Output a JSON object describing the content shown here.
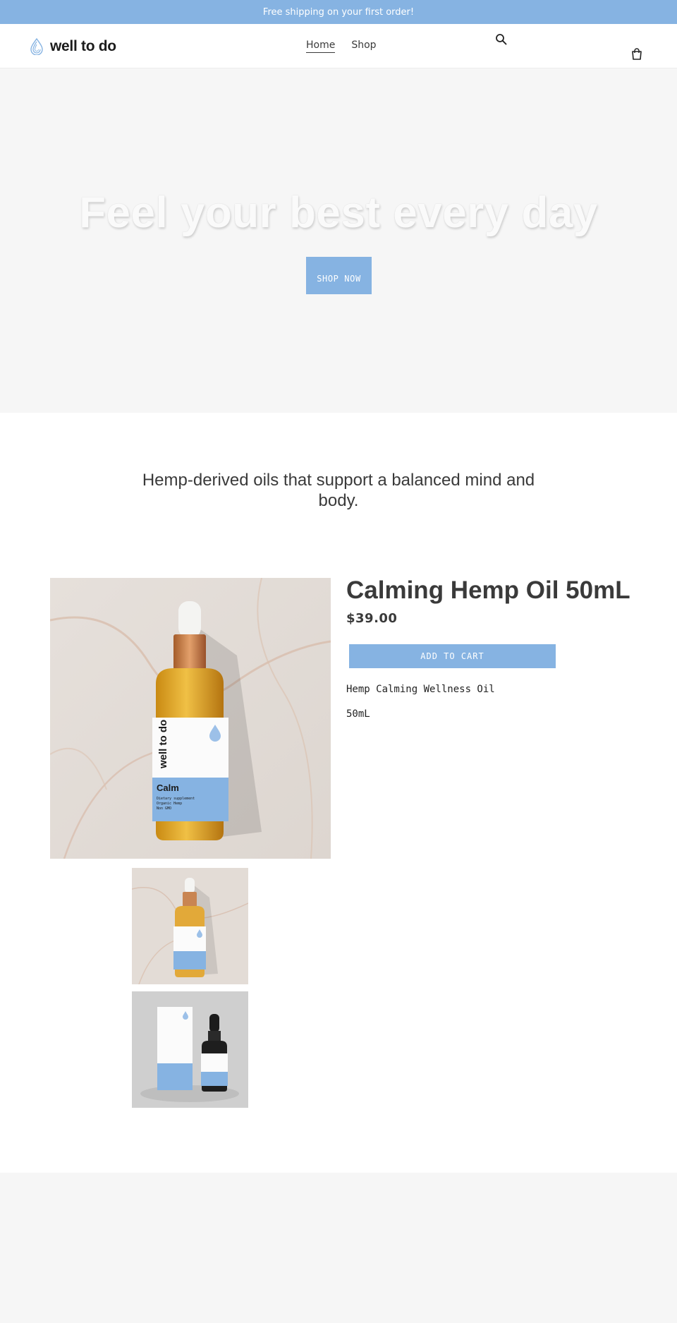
{
  "announcement": "Free shipping on your first order!",
  "brand": {
    "name": "well to do"
  },
  "nav": [
    {
      "label": "Home",
      "active": true
    },
    {
      "label": "Shop",
      "active": false
    }
  ],
  "icons": {
    "search": "search-icon",
    "cart": "cart-icon",
    "logo": "droplet-logo-icon"
  },
  "hero": {
    "title": "Feel your best every day",
    "button_label": "SHOP NOW"
  },
  "tagline": "Hemp-derived oils that support a balanced mind and body.",
  "product": {
    "title": "Calming Hemp Oil 50mL",
    "price": "$39.00",
    "add_to_cart": "ADD TO CART",
    "description_lines": [
      "Hemp Calming Wellness Oil",
      "50mL"
    ],
    "label": {
      "brand": "well to do",
      "name": "Calm",
      "details": [
        "Dietary supplement",
        "Organic Hemp",
        "Non GMO"
      ]
    }
  },
  "colors": {
    "accent": "#86b3e2",
    "text": "#3a3a3a",
    "hero_bg": "#f6f6f6"
  }
}
